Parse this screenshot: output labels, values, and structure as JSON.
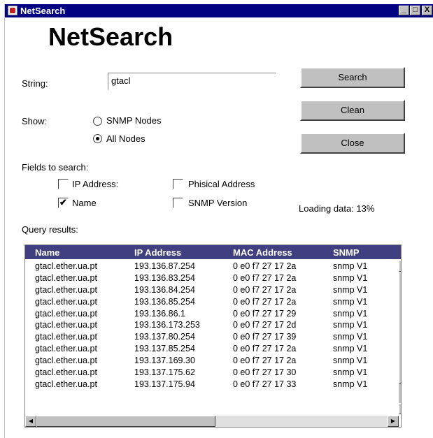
{
  "window": {
    "title": "NetSearch",
    "controls": [
      "_",
      "□",
      "X"
    ]
  },
  "app_title": "NetSearch",
  "search": {
    "label": "String:",
    "value": "gtacl"
  },
  "show": {
    "label": "Show:",
    "options": [
      "SNMP Nodes",
      "All Nodes"
    ],
    "selected": "All Nodes"
  },
  "buttons": {
    "search": "Search",
    "clean": "Clean",
    "close": "Close"
  },
  "fields": {
    "label": "Fields to search:",
    "items": [
      {
        "label": "IP Address:",
        "checked": false
      },
      {
        "label": "Phisical Address",
        "checked": false
      },
      {
        "label": "Name",
        "checked": true
      },
      {
        "label": "SNMP Version",
        "checked": false
      }
    ]
  },
  "loading": {
    "text": "Loading data: 13%",
    "progress": 0.13
  },
  "results": {
    "label": "Query results:",
    "columns": [
      "Name",
      "IP Address",
      "MAC Address",
      "SNMP"
    ],
    "rows": [
      [
        "gtacl.ether.ua.pt",
        "193.136.87.254",
        "0 e0 f7 27 17 2a",
        "snmp V1"
      ],
      [
        "gtacl.ether.ua.pt",
        "193.136.83.254",
        "0 e0 f7 27 17 2a",
        "snmp V1"
      ],
      [
        "gtacl.ether.ua.pt",
        "193.136.84.254",
        "0 e0 f7 27 17 2a",
        "snmp V1"
      ],
      [
        "gtacl.ether.ua.pt",
        "193.136.85.254",
        "0 e0 f7 27 17 2a",
        "snmp V1"
      ],
      [
        "gtacl.ether.ua.pt",
        "193.136.86.1",
        "0 e0 f7 27 17 29",
        "snmp V1"
      ],
      [
        "gtacl.ether.ua.pt",
        "193.136.173.253",
        "0 e0 f7 27 17 2d",
        "snmp V1"
      ],
      [
        "gtacl.ether.ua.pt",
        "193.137.80.254",
        "0 e0 f7 27 17 39",
        "snmp V1"
      ],
      [
        "gtacl.ether.ua.pt",
        "193.137.85.254",
        "0 e0 f7 27 17 2a",
        "snmp V1"
      ],
      [
        "gtacl.ether.ua.pt",
        "193.137.169.30",
        "0 e0 f7 27 17 2a",
        "snmp V1"
      ],
      [
        "gtacl.ether.ua.pt",
        "193.137.175.62",
        "0 e0 f7 27 17 30",
        "snmp V1"
      ],
      [
        "gtacl.ether.ua.pt",
        "193.137.175.94",
        "0 e0 f7 27 17 33",
        "snmp V1"
      ]
    ]
  },
  "colors": {
    "titlebar": "#000080",
    "table_header": "#404080",
    "button_face": "#c0c0c0"
  }
}
